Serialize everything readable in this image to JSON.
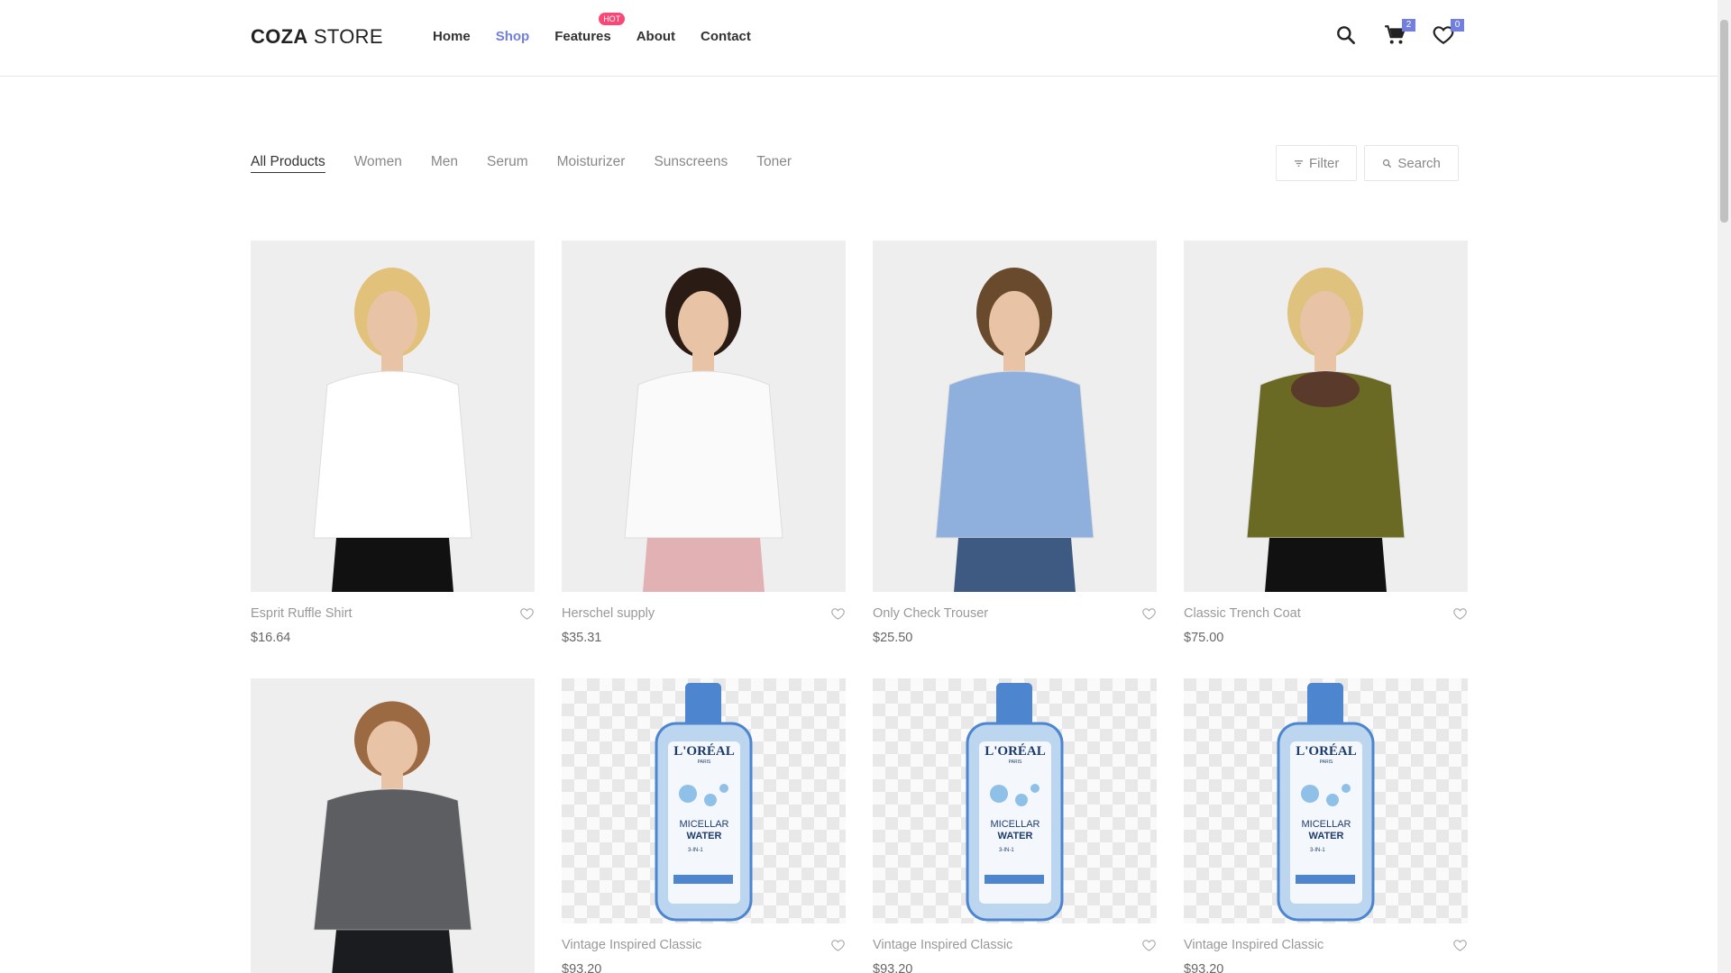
{
  "brand": {
    "bold": "COZA",
    "rest": " STORE"
  },
  "nav": {
    "items": [
      {
        "label": "Home",
        "active": false
      },
      {
        "label": "Shop",
        "active": true
      },
      {
        "label": "Features",
        "active": false,
        "badge": "HOT"
      },
      {
        "label": "About",
        "active": false
      },
      {
        "label": "Contact",
        "active": false
      }
    ]
  },
  "header_icons": {
    "search": "search-icon",
    "cart": {
      "icon": "cart-icon",
      "count": "2"
    },
    "wishlist": {
      "icon": "heart-icon",
      "count": "0"
    }
  },
  "categories": [
    {
      "label": "All Products",
      "active": true
    },
    {
      "label": "Women",
      "active": false
    },
    {
      "label": "Men",
      "active": false
    },
    {
      "label": "Serum",
      "active": false
    },
    {
      "label": "Moisturizer",
      "active": false
    },
    {
      "label": "Sunscreens",
      "active": false
    },
    {
      "label": "Toner",
      "active": false
    }
  ],
  "tools": {
    "filter": "Filter",
    "search": "Search"
  },
  "products": [
    {
      "name": "Esprit Ruffle Shirt",
      "price": "$16.64",
      "image": "woman-white-tshirt"
    },
    {
      "name": "Herschel supply",
      "price": "$35.31",
      "image": "woman-white-shirt-pink-pants"
    },
    {
      "name": "Only Check Trouser",
      "price": "$25.50",
      "image": "man-blue-check-shirt"
    },
    {
      "name": "Classic Trench Coat",
      "price": "$75.00",
      "image": "woman-olive-trench-coat"
    },
    {
      "name": "",
      "price": "",
      "image": "woman-grey-denim-shirt"
    },
    {
      "name": "Vintage Inspired Classic",
      "price": "$93.20",
      "image": "loreal-micellar-water"
    },
    {
      "name": "Vintage Inspired Classic",
      "price": "$93.20",
      "image": "loreal-micellar-water"
    },
    {
      "name": "Vintage Inspired Classic",
      "price": "$93.20",
      "image": "loreal-micellar-water"
    }
  ],
  "bottle": {
    "brand": "L'ORÉAL",
    "sub": "PARIS",
    "line1": "MICELLAR",
    "line2": "WATER",
    "line3": "3-IN-1"
  },
  "colors": {
    "accent": "#717fe0",
    "hot": "#f74877"
  }
}
